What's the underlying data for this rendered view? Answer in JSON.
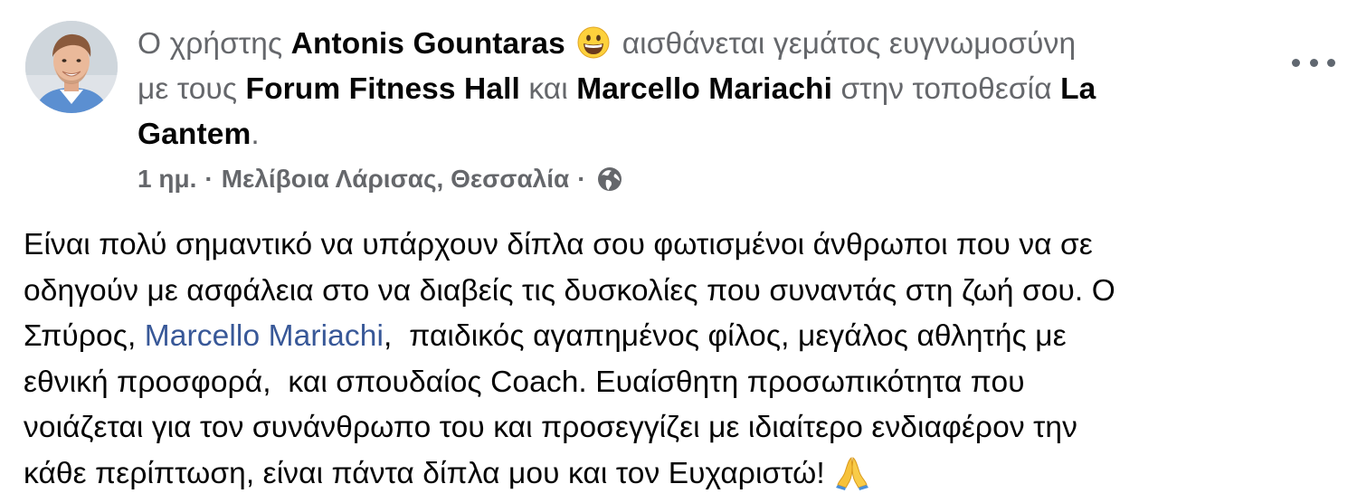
{
  "post": {
    "author_prefix": "Ο χρήστης",
    "author": "Antonis Gountaras",
    "feeling_emoji_icon": "grinning-face-emoji",
    "feeling_text": "αισθάνεται γεμάτος ευγνωμοσύνη",
    "with_prefix": "με τους",
    "tagged_1": "Forum Fitness Hall",
    "and_word": "και",
    "tagged_2": "Marcello Mariachi",
    "location_prefix": "στην τοποθεσία",
    "location_line1": "La",
    "location_line2": "Gantem",
    "period": ".",
    "time": "1 ημ.",
    "dot": "·",
    "place": "Μελίβοια Λάρισας, Θεσσαλία",
    "privacy_icon": "globe-icon",
    "more_icon": "more-horizontal-icon"
  },
  "body": {
    "line1": "Είναι πολύ σημαντικό να υπάρχουν δίπλα σου φωτισμένοι άνθρωποι που να σε",
    "line2": "οδηγούν με ασφάλεια στο να διαβείς τις δυσκολίες που συναντάς στη ζωή σου. Ο",
    "line3_prefix": "Σπύρος, ",
    "line3_mention": "Marcello Mariachi",
    "line3_suffix": ",  παιδικός αγαπημένος φίλος, μεγάλος αθλητής με",
    "line4": "εθνική προσφορά,  και σπουδαίος Coach. Ευαίσθητη προσωπικότητα που",
    "line5": "νοιάζεται για τον συνάνθρωπο του και προσεγγίζει με ιδιαίτερο ενδιαφέρον την",
    "line6": "κάθε περίπτωση, είναι πάντα δίπλα μου και τον Ευχαριστώ!",
    "end_emoji_icon": "folded-hands-emoji"
  },
  "colors": {
    "text": "#050505",
    "secondary": "#65676b",
    "link": "#385898"
  }
}
